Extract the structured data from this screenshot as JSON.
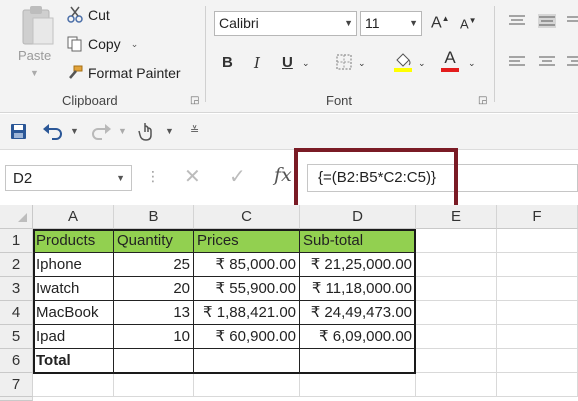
{
  "ribbon": {
    "clipboard": {
      "paste_label": "Paste",
      "cut_label": "Cut",
      "copy_label": "Copy",
      "format_painter_label": "Format Painter",
      "group_label": "Clipboard"
    },
    "font": {
      "font_name": "Calibri",
      "font_size": "11",
      "bold": "B",
      "italic": "I",
      "underline": "U",
      "font_color_letter": "A",
      "grow_letter": "A",
      "shrink_letter": "A",
      "group_label": "Font",
      "fill_color": "#ffff00",
      "font_color": "#ff0000"
    }
  },
  "formula_bar": {
    "name_box": "D2",
    "formula": "{=(B2:B5*C2:C5)}",
    "highlight_color": "#7a1b25"
  },
  "sheet": {
    "columns": [
      "A",
      "B",
      "C",
      "D",
      "E",
      "F"
    ],
    "rows": [
      "1",
      "2",
      "3",
      "4",
      "5",
      "6",
      "7"
    ],
    "header_fill": "#92d050",
    "cells": {
      "A1": "Products",
      "B1": "Quantity",
      "C1": "Prices",
      "D1": "Sub-total",
      "A2": "Iphone",
      "B2": "25",
      "C2": "₹ 85,000.00",
      "D2": "₹ 21,25,000.00",
      "A3": "Iwatch",
      "B3": "20",
      "C3": "₹ 55,900.00",
      "D3": "₹ 11,18,000.00",
      "A4": "MacBook",
      "B4": "13",
      "C4": "₹ 1,88,421.00",
      "D4": "₹ 24,49,473.00",
      "A5": "Ipad",
      "B5": "10",
      "C5": "₹ 60,900.00",
      "D5": "₹ 6,09,000.00",
      "A6": "Total"
    }
  }
}
